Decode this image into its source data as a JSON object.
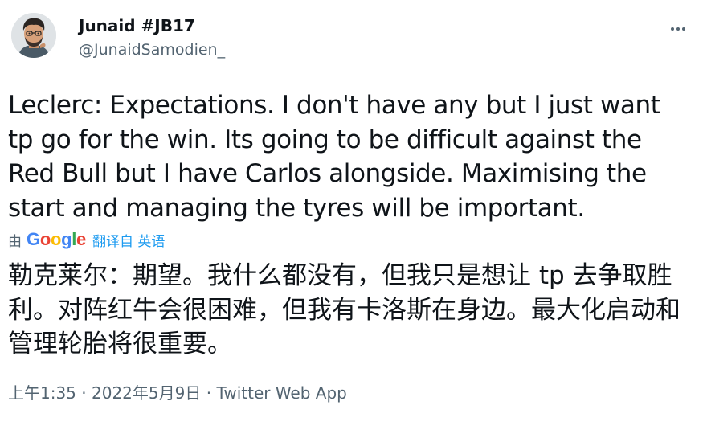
{
  "author": {
    "display_name": "Junaid #JB17",
    "handle": "@JunaidSamodien_"
  },
  "tweet": {
    "text": "Leclerc: Expectations. I don't have any but I just want tp go for the win. Its going to be difficult against the Red Bull but I have Carlos alongside. Maximising the start and managing the tyres will be important.",
    "translation_by": "由",
    "translation_provider": "Google",
    "translation_link": "翻译自 英语",
    "translated_text": "勒克莱尔：期望。我什么都没有，但我只是想让 tp 去争取胜利。对阵红牛会很困难，但我有卡洛斯在身边。最大化启动和管理轮胎将很重要。",
    "time": "上午1:35",
    "separator1": "·",
    "date": "2022年5月9日",
    "separator2": "·",
    "source": "Twitter Web App"
  },
  "colors": {
    "text_primary": "#0f1419",
    "text_secondary": "#536471",
    "link": "#1d9bf0",
    "google_blue": "#4285f4",
    "google_red": "#ea4335",
    "google_yellow": "#fbbc05",
    "google_green": "#34a853"
  },
  "icons": {
    "more": "more-horizontal-icon",
    "avatar": "bitmoji-avatar"
  }
}
